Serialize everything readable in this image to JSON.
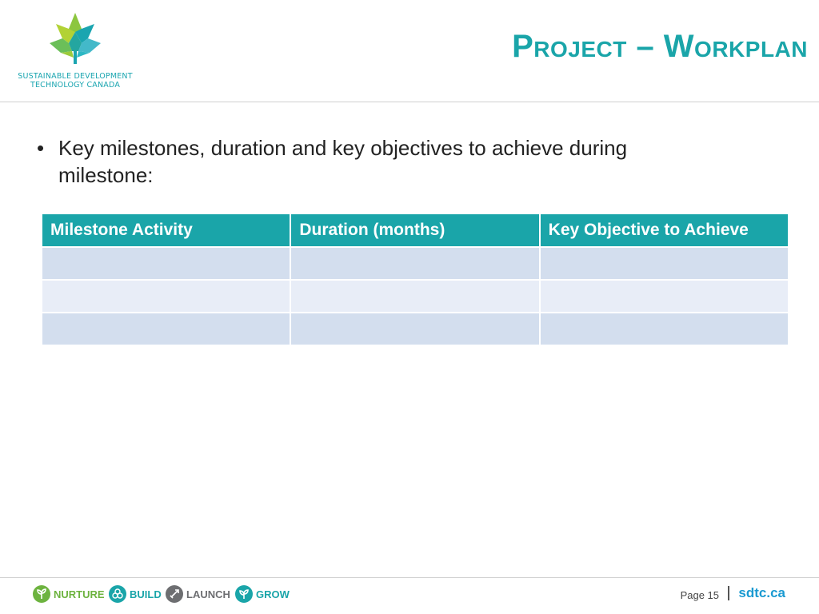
{
  "logo": {
    "line1": "SUSTAINABLE DEVELOPMENT",
    "line2": "TECHNOLOGY CANADA",
    "icon": "maple-leaf-icon"
  },
  "title": "Project – Workplan",
  "bullet": "Key milestones, duration and key objectives to achieve during milestone:",
  "table": {
    "headers": [
      "Milestone Activity",
      "Duration (months)",
      "Key Objective to Achieve"
    ],
    "rows": [
      [
        "",
        "",
        ""
      ],
      [
        "",
        "",
        ""
      ],
      [
        "",
        "",
        ""
      ]
    ]
  },
  "footer": {
    "stages": [
      {
        "label": "NURTURE",
        "icon": "sprout-icon",
        "color": "#6db33f"
      },
      {
        "label": "BUILD",
        "icon": "blocks-icon",
        "color": "#1aa5a9"
      },
      {
        "label": "LAUNCH",
        "icon": "rocket-icon",
        "color": "#6d6e71"
      },
      {
        "label": "GROW",
        "icon": "plant-icon",
        "color": "#1aa5a9"
      }
    ],
    "page": "Page 15",
    "site": "sdtc.ca"
  },
  "colors": {
    "accent": "#1aa5a9",
    "row_dark": "#d3deee",
    "row_light": "#e8edf7"
  }
}
